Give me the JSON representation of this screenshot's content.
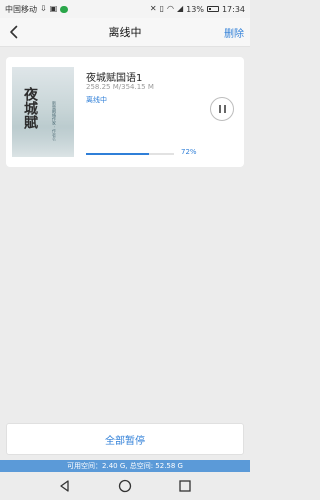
{
  "status_bar": {
    "carrier": "中国移动",
    "battery": "13%",
    "time": "17:34"
  },
  "nav": {
    "title": "离线中",
    "delete_label": "删除"
  },
  "download_item": {
    "cover_title": "夜城賦",
    "cover_subtitle": "新晉網絡作家 · 作者名",
    "title": "夜城赋国语1",
    "size": "258.25 M/354.15 M",
    "status": "离线中",
    "progress_percent": 72,
    "progress_text": "72%"
  },
  "footer": {
    "pause_all_label": "全部暂停",
    "storage_text": "可用空间：2.40 G, 总空间: 52.58 G"
  },
  "colors": {
    "accent": "#2f7fd8",
    "storage_bar": "#5b9ad8",
    "background": "#ececec"
  },
  "icons": [
    "back-icon",
    "pause-icon",
    "android-back-icon",
    "android-home-icon",
    "android-recents-icon"
  ]
}
